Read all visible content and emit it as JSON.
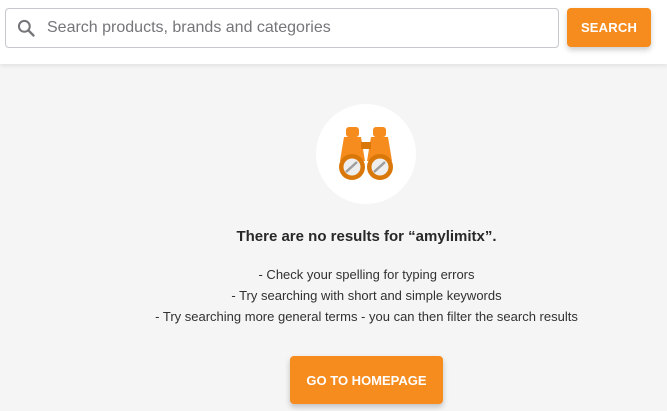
{
  "search": {
    "placeholder": "Search products, brands and categories",
    "value": "",
    "button_label": "SEARCH",
    "icon": "search-icon"
  },
  "empty_state": {
    "illustration_icon": "binoculars-icon",
    "headline": "There are no results for “amylimitx”.",
    "tips": [
      "- Check your spelling for typing errors",
      "- Try searching with short and simple keywords",
      "- Try searching more general terms - you can then filter the search results"
    ],
    "home_button_label": "GO TO HOMEPAGE"
  },
  "colors": {
    "accent": "#f68b1e",
    "accent_dark": "#d97709",
    "background": "#f5f5f5",
    "surface": "#ffffff",
    "text": "#313133"
  }
}
